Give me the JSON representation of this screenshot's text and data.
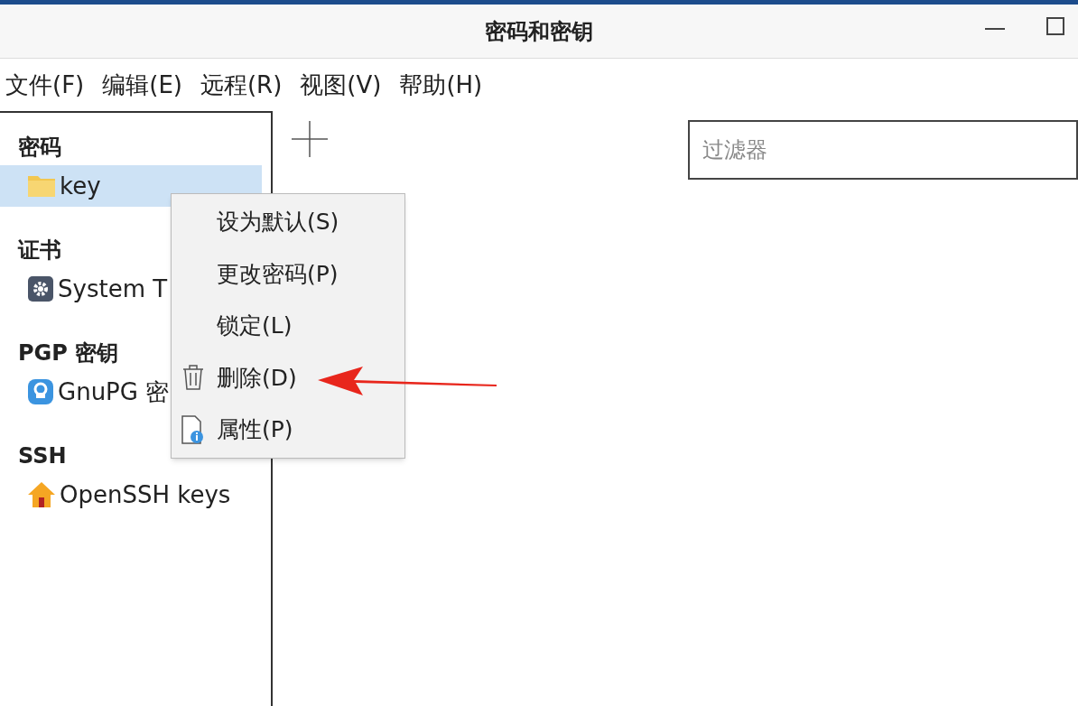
{
  "window": {
    "title": "密码和密钥"
  },
  "menubar": [
    "文件(F)",
    "编辑(E)",
    "远程(R)",
    "视图(V)",
    "帮助(H)"
  ],
  "sidebar": [
    {
      "heading": "密码",
      "items": [
        {
          "label": "key",
          "kind": "folder",
          "selected": true
        }
      ]
    },
    {
      "heading": "证书",
      "items": [
        {
          "label": "System T",
          "kind": "gear",
          "selected": false
        }
      ]
    },
    {
      "heading": "PGP 密钥",
      "items": [
        {
          "label": "GnuPG 密",
          "kind": "gnupg",
          "selected": false
        }
      ]
    },
    {
      "heading": "SSH",
      "items": [
        {
          "label": "OpenSSH keys",
          "kind": "home",
          "selected": false
        }
      ]
    }
  ],
  "filter": {
    "placeholder": "过滤器"
  },
  "context_menu": [
    {
      "label": "设为默认(S)",
      "kind": "plain"
    },
    {
      "label": "更改密码(P)",
      "kind": "plain"
    },
    {
      "label": "锁定(L)",
      "kind": "plain"
    },
    {
      "label": "删除(D)",
      "kind": "trash"
    },
    {
      "label": "属性(P)",
      "kind": "info"
    }
  ]
}
